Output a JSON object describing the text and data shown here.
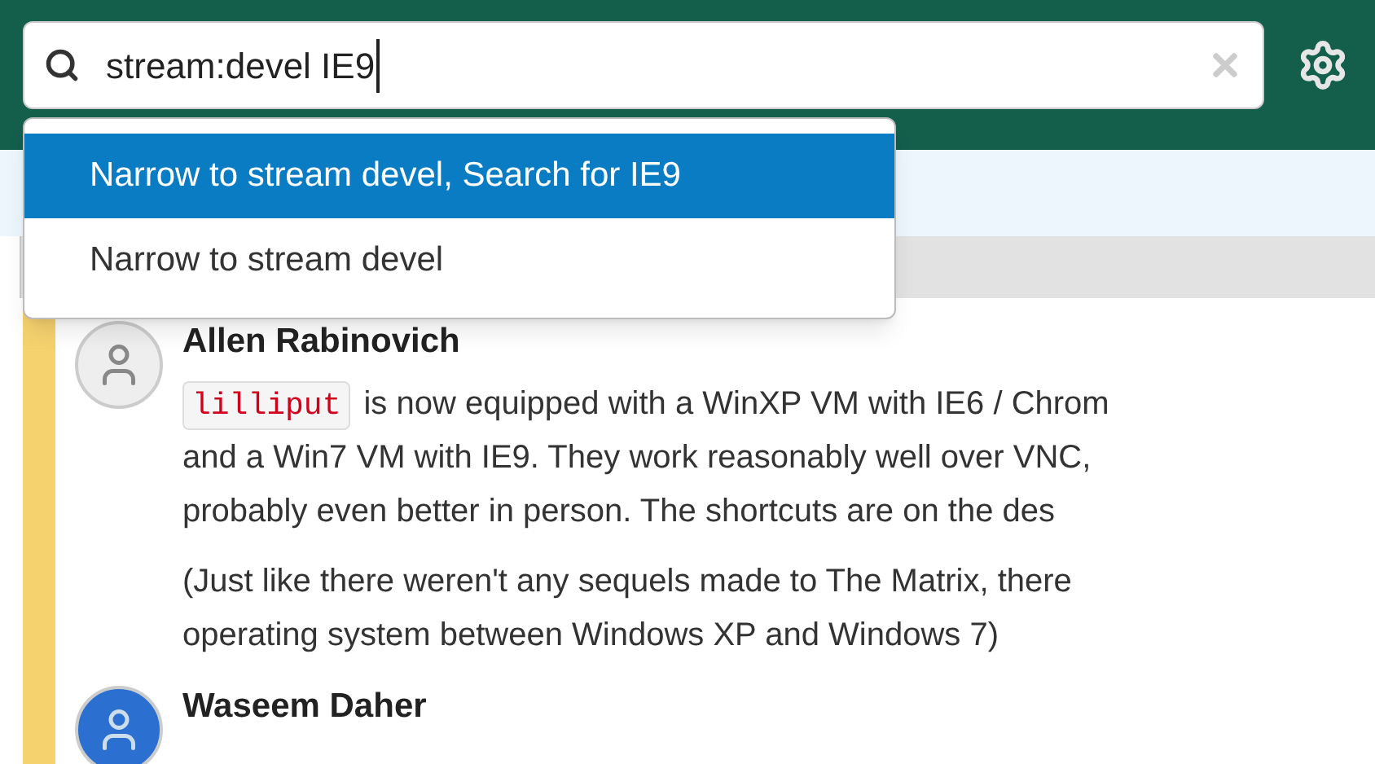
{
  "search": {
    "value": "stream:devel IE9"
  },
  "suggestions": [
    {
      "label": "Narrow to stream devel, Search for IE9",
      "selected": true
    },
    {
      "label": "Narrow to stream devel",
      "selected": false
    }
  ],
  "messages": [
    {
      "sender": "Allen Rabinovich",
      "paragraphs": [
        {
          "code": "lilliput",
          "lines": [
            "is now equipped with a WinXP VM with IE6 / Chrom",
            "and a Win7 VM with IE9. They work reasonably well over VNC,",
            "probably even better in person. The shortcuts are on the des"
          ]
        },
        {
          "lines": [
            "(Just like there weren't any sequels made to The Matrix, there",
            "operating system between Windows XP and Windows 7)"
          ]
        }
      ]
    },
    {
      "sender": "Waseem Daher"
    }
  ]
}
